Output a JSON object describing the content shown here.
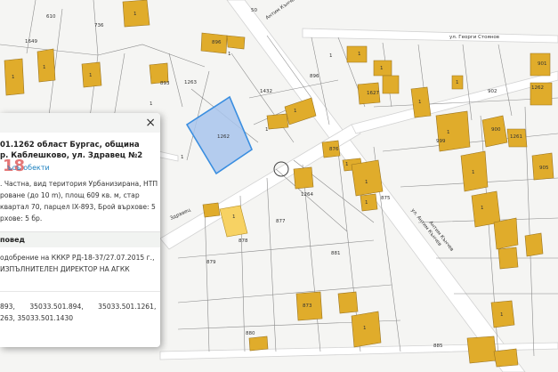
{
  "map": {
    "streets": {
      "top_right": "ул. Георги Стоянов",
      "diagonal_right": "Антим Кънчев",
      "diagonal_lower": "ул. Антим Кънчев",
      "small_bottom_right": "ул. Антим Кънчев",
      "mid_left": "Здравец",
      "top_center": "Антим Кънчев",
      "top_number": "50"
    },
    "parcels": [
      "1649",
      "610",
      "736",
      "1",
      "1",
      "1",
      "1",
      "896",
      "1",
      "893",
      "1263",
      "1432",
      "896",
      "1",
      "1",
      "1",
      "1627",
      "1",
      "1",
      "901",
      "902",
      "1262",
      "894",
      "1",
      "1",
      "1",
      "1",
      "900",
      "1261",
      "1",
      "876",
      "1",
      "999",
      "905",
      "877",
      "1264",
      "875",
      "878",
      "1",
      "1",
      "879",
      "1",
      "880",
      "881",
      "873",
      "1",
      "885",
      "1",
      "1",
      "1",
      "1430",
      "1",
      "1",
      "1"
    ],
    "selected_parcel": "1262",
    "scale_hint": "1:1",
    "colors": {
      "building": "#e0ac2b",
      "selected": "#a8c4ec",
      "highlight": "#f7d263",
      "road": "#ffffff"
    }
  },
  "popup": {
    "close_label": "×",
    "title_line1": "01.1262 област Бургас, община",
    "title_line2": "р. Каблешково, ул. Здравец №2",
    "overlay_number": "18",
    "objects_link": "ъсъ обекти",
    "desc_lines": [
      ". Частна, вид територия Урбанизирана, НТП",
      "роване (до 10 m), площ 609 кв. м, стар",
      "квартал 70, парцел IX-893, Брой върхове: 5",
      "рхове: 5 бр."
    ],
    "section_title": "повед",
    "body_lines": [
      "одобрение на КККР РД-18-37/27.07.2015 г.,",
      "ИЗПЪЛНИТЕЛЕН ДИРЕКТОР НА АГКК"
    ],
    "refs_row1": [
      "893,",
      "35033.501.894,",
      "35033.501.1261,"
    ],
    "refs_row2": [
      "263, 35033.501.1430"
    ]
  }
}
